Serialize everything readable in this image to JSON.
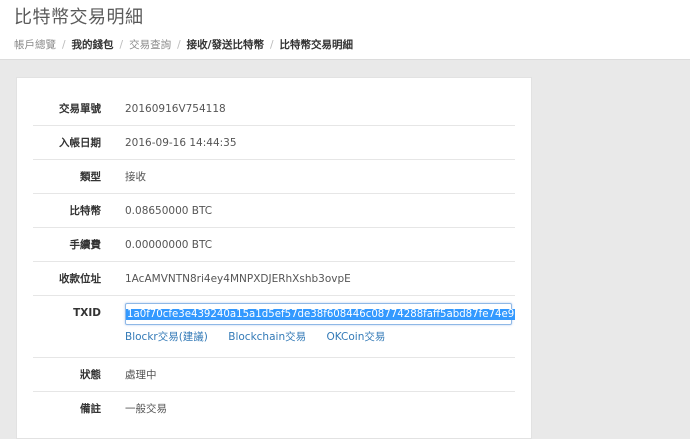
{
  "header": {
    "title": "比特幣交易明細",
    "breadcrumb": [
      "帳戶總覽",
      "我的錢包",
      "交易查詢",
      "接收/發送比特幣",
      "比特幣交易明細"
    ]
  },
  "details": {
    "tx_number": {
      "label": "交易單號",
      "value": "20160916V754118"
    },
    "date": {
      "label": "入帳日期",
      "value": "2016-09-16 14:44:35"
    },
    "type": {
      "label": "類型",
      "value": "接收"
    },
    "amount": {
      "label": "比特幣",
      "value": "0.08650000 BTC"
    },
    "fee": {
      "label": "手續費",
      "value": "0.00000000 BTC"
    },
    "address": {
      "label": "收款位址",
      "value": "1AcAMVNTN8ri4ey4MNPXDJERhXshb3ovpE"
    },
    "txid": {
      "label": "TXID",
      "value": "1a0f70cfe3e439240a15a1d5ef57de38f608446c08774288faff5abd87fe74e9"
    },
    "status": {
      "label": "狀態",
      "value": "處理中"
    },
    "note": {
      "label": "備註",
      "value": "一般交易"
    }
  },
  "explorer_links": [
    "Blockr交易(建議)",
    "Blockchain交易",
    "OKCoin交易"
  ]
}
